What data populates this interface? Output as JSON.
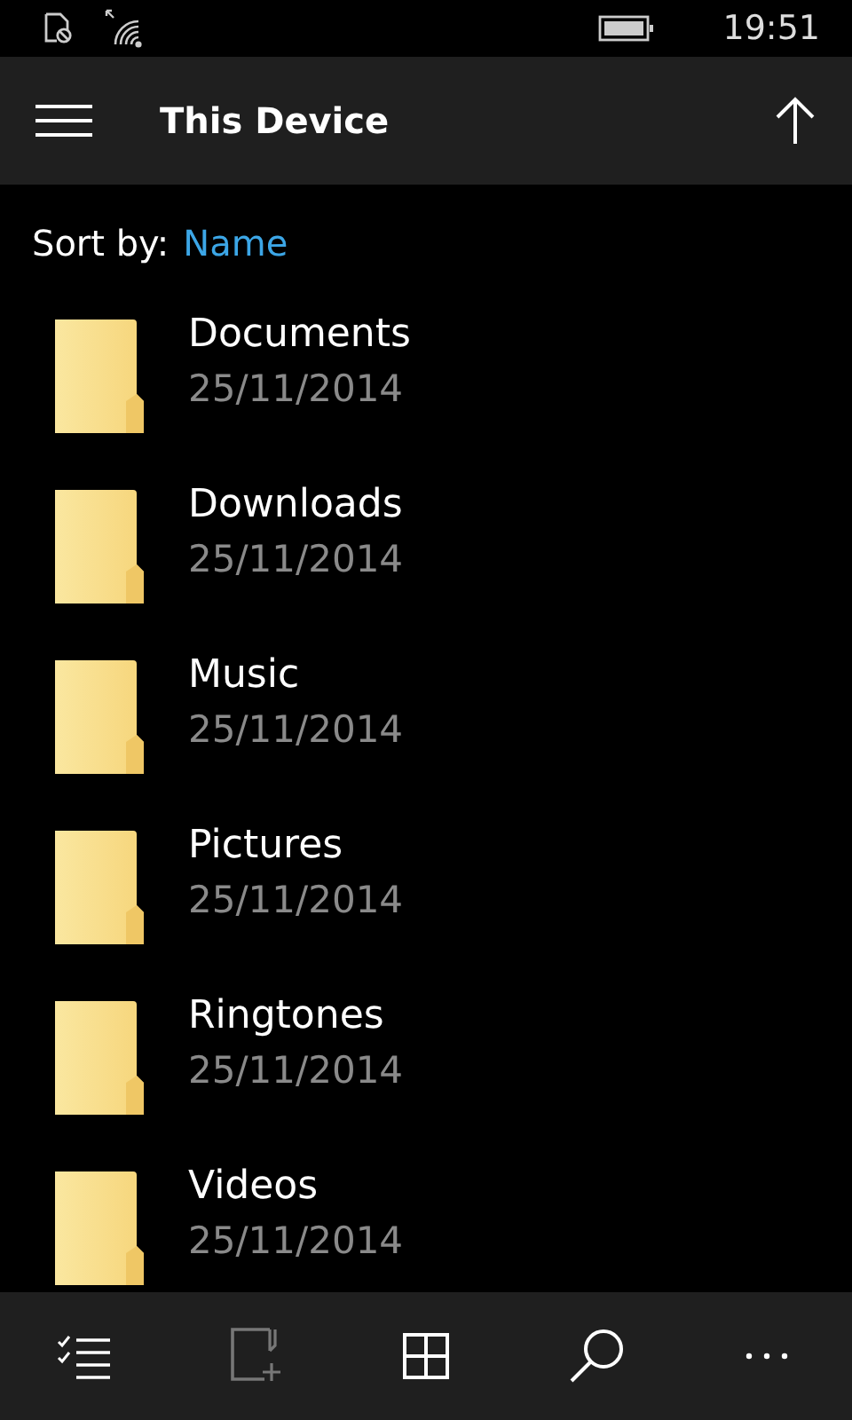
{
  "status_bar": {
    "time": "19:51"
  },
  "header": {
    "title": "This Device"
  },
  "sort": {
    "label": "Sort by:",
    "value": "Name"
  },
  "folders": [
    {
      "name": "Documents",
      "date": "25/11/2014"
    },
    {
      "name": "Downloads",
      "date": "25/11/2014"
    },
    {
      "name": "Music",
      "date": "25/11/2014"
    },
    {
      "name": "Pictures",
      "date": "25/11/2014"
    },
    {
      "name": "Ringtones",
      "date": "25/11/2014"
    },
    {
      "name": "Videos",
      "date": "25/11/2014"
    }
  ],
  "app_bar": {
    "buttons": [
      {
        "kind": "select",
        "disabled": false
      },
      {
        "kind": "new-folder",
        "disabled": true
      },
      {
        "kind": "tiles",
        "disabled": false
      },
      {
        "kind": "search",
        "disabled": false
      },
      {
        "kind": "more",
        "disabled": false
      }
    ]
  }
}
